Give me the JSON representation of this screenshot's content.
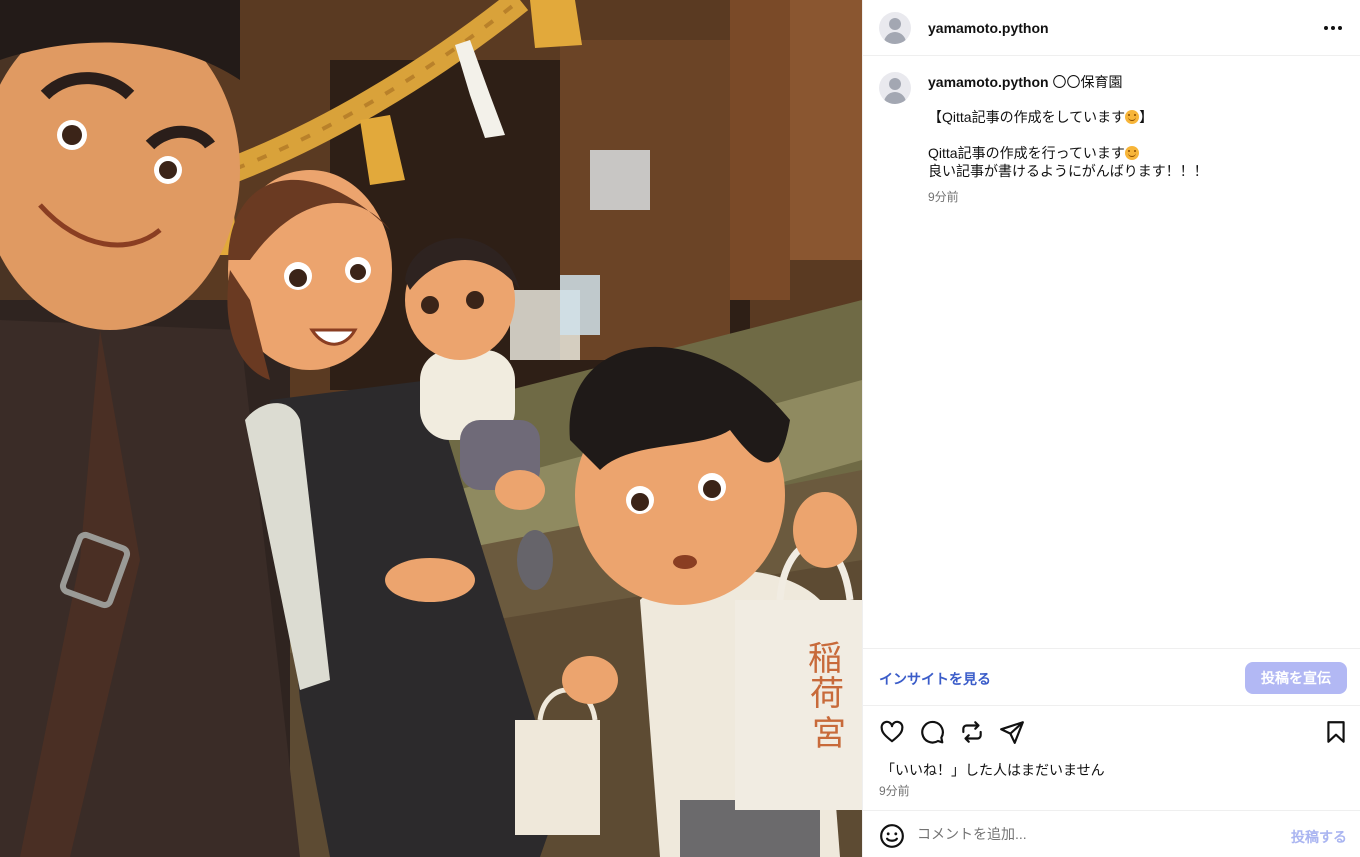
{
  "post": {
    "username": "yamamoto.python",
    "more_icon": "more-horizontal-icon",
    "image_alt": "Illustrated family photo at a shrine"
  },
  "caption": {
    "username": "yamamoto.python",
    "location": "〇〇保育園",
    "line1": "【Qitta記事の作成をしています",
    "line1_end": "】",
    "line2": "Qitta記事の作成を行っています",
    "line3": "良い記事が書けるようにがんばります！！！",
    "time": "9分前"
  },
  "insights": {
    "link_label": "インサイトを見る",
    "promote_label": "投稿を宣伝"
  },
  "actions": {
    "icons": [
      "heart-icon",
      "comment-icon",
      "repost-icon",
      "share-icon",
      "bookmark-icon"
    ]
  },
  "likes": {
    "text": "「いいね！」した人はまだいません",
    "time": "9分前"
  },
  "comment": {
    "placeholder": "コメントを追加...",
    "post_label": "投稿する"
  },
  "colors": {
    "link_blue": "#3a5cc9",
    "promote_bg": "#b2b8f4",
    "post_disabled": "#aab5f1",
    "muted": "#737373"
  }
}
